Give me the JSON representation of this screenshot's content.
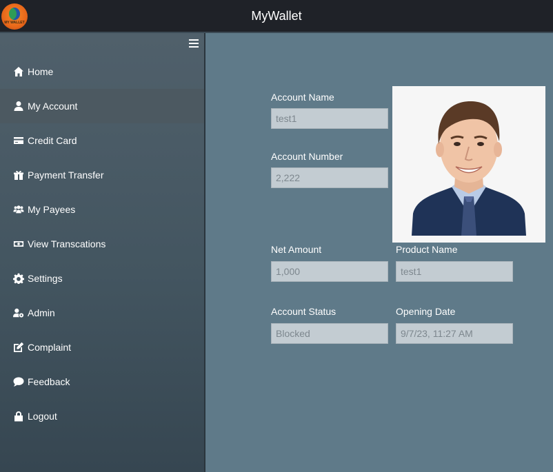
{
  "app": {
    "title": "MyWallet",
    "logo_text": "MY WALLET"
  },
  "sidebar": {
    "items": [
      {
        "label": "Home",
        "icon": "home-icon"
      },
      {
        "label": "My Account",
        "icon": "user-icon",
        "active": true
      },
      {
        "label": "Credit Card",
        "icon": "credit-card-icon"
      },
      {
        "label": "Payment Transfer",
        "icon": "transfer-icon"
      },
      {
        "label": "My Payees",
        "icon": "users-icon"
      },
      {
        "label": "View Transcations",
        "icon": "money-icon"
      },
      {
        "label": "Settings",
        "icon": "gear-icon"
      },
      {
        "label": "Admin",
        "icon": "user-gear-icon"
      },
      {
        "label": "Complaint",
        "icon": "edit-icon"
      },
      {
        "label": "Feedback",
        "icon": "comment-icon"
      },
      {
        "label": "Logout",
        "icon": "lock-icon"
      }
    ]
  },
  "account": {
    "account_name_label": "Account Name",
    "account_name_value": "test1",
    "account_number_label": "Account Number",
    "account_number_value": "2,222",
    "net_amount_label": "Net Amount",
    "net_amount_value": "1,000",
    "product_name_label": "Product Name",
    "product_name_value": "test1",
    "account_status_label": "Account Status",
    "account_status_value": "Blocked",
    "opening_date_label": "Opening Date",
    "opening_date_value": "9/7/23, 11:27 AM"
  },
  "colors": {
    "topbar": "#1f2228",
    "content_bg": "#5f7a89",
    "sidebar_top": "#50606b",
    "sidebar_bottom": "#364651",
    "active_item": "#4c5961",
    "input_bg": "#c3ccd2"
  }
}
